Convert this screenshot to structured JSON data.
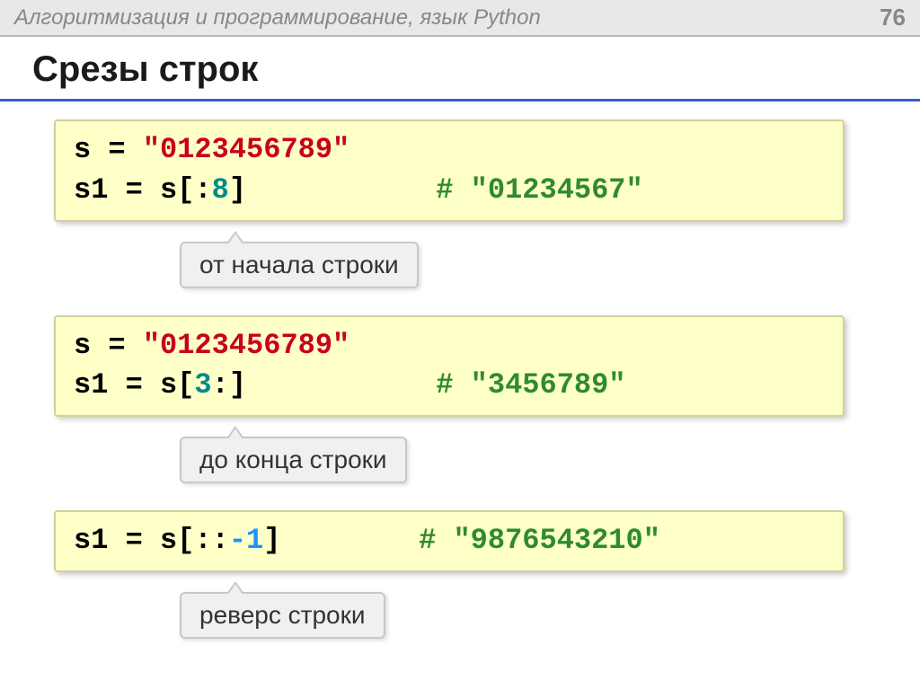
{
  "header": {
    "breadcrumb": "Алгоритмизация и программирование, язык Python",
    "page_number": "76"
  },
  "title": "Срезы строк",
  "sections": [
    {
      "code": {
        "line1_left": "s = ",
        "line1_str": "\"0123456789\"",
        "line2_left": "s1 = s[:",
        "line2_num": "8",
        "line2_right": "]",
        "line2_pad": "           ",
        "line2_comment": "# \"01234567\""
      },
      "callout": "от начала строки"
    },
    {
      "code": {
        "line1_left": "s = ",
        "line1_str": "\"0123456789\"",
        "line2_left": "s1 = s[",
        "line2_num": "3",
        "line2_right": ":]",
        "line2_pad": "           ",
        "line2_comment": "# \"3456789\""
      },
      "callout": "до конца строки"
    },
    {
      "code": {
        "line1_left": "s1 = s[::",
        "line1_neg": "-1",
        "line1_right": "]",
        "line1_pad": "        ",
        "line1_comment": "# \"9876543210\""
      },
      "callout": "реверс строки"
    }
  ]
}
